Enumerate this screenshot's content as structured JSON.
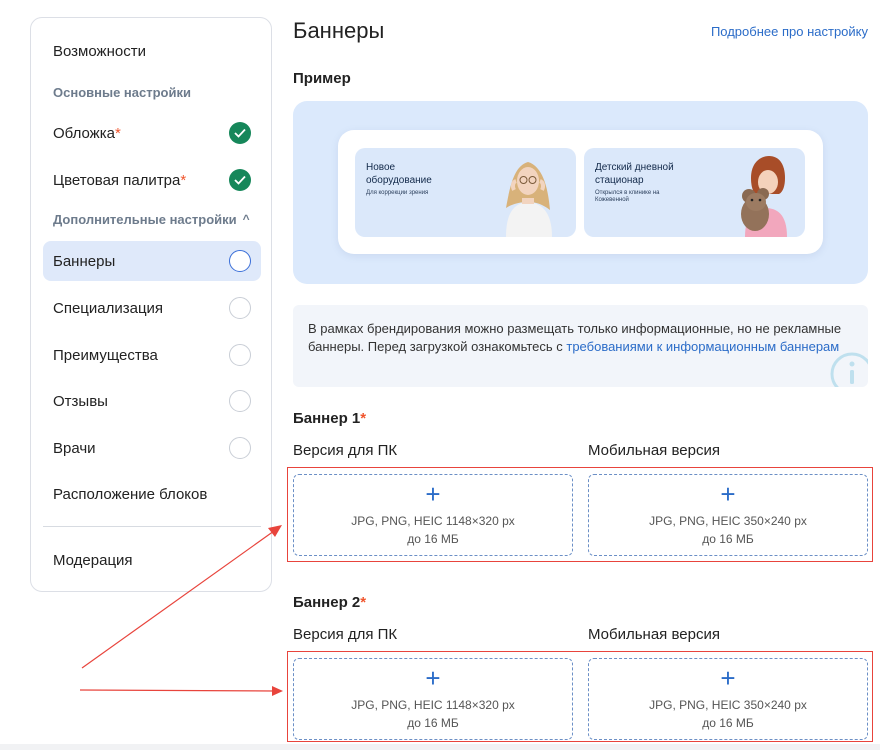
{
  "sidebar": {
    "features": "Возможности",
    "basic_section": "Основные настройки",
    "cover": "Обложка",
    "palette": "Цветовая палитра",
    "additional_section": "Дополнительные настройки",
    "additional_chevron": "^",
    "banners": "Баннеры",
    "specialization": "Специализация",
    "advantages": "Преимущества",
    "reviews": "Отзывы",
    "doctors": "Врачи",
    "layout": "Расположение блоков",
    "moderation": "Модерация",
    "required_mark": "*"
  },
  "main": {
    "title": "Баннеры",
    "help_link": "Подробнее про настройку",
    "example_heading": "Пример",
    "example_banners": [
      {
        "title_line1": "Новое",
        "title_line2": "оборудование",
        "subtitle": "Для коррекции зрения"
      },
      {
        "title_line1": "Детский дневной",
        "title_line2": "стационар",
        "subtitle_line1": "Открылся в клинике на",
        "subtitle_line2": "Кожевенной"
      }
    ],
    "info_text_before": "В рамках брендирования можно размещать только информационные, но не рекламные баннеры. Перед загрузкой ознакомьтесь с ",
    "info_link": "требованиями к информационным баннерам",
    "banner1_title": "Баннер 1",
    "banner2_title": "Баннер 2",
    "pc_label": "Версия для ПК",
    "mobile_label": "Мобильная версия",
    "plus": "+",
    "pc_formats": "JPG, PNG, HEIC 1148×320 px",
    "mobile_formats": "JPG, PNG, HEIC 350×240 px",
    "max_size": "до 16 МБ"
  },
  "colors": {
    "accent": "#2b6cc8",
    "success": "#16875a",
    "required": "#f0552d",
    "highlight": "#e8443c",
    "active_bg": "#dfe9fa"
  }
}
